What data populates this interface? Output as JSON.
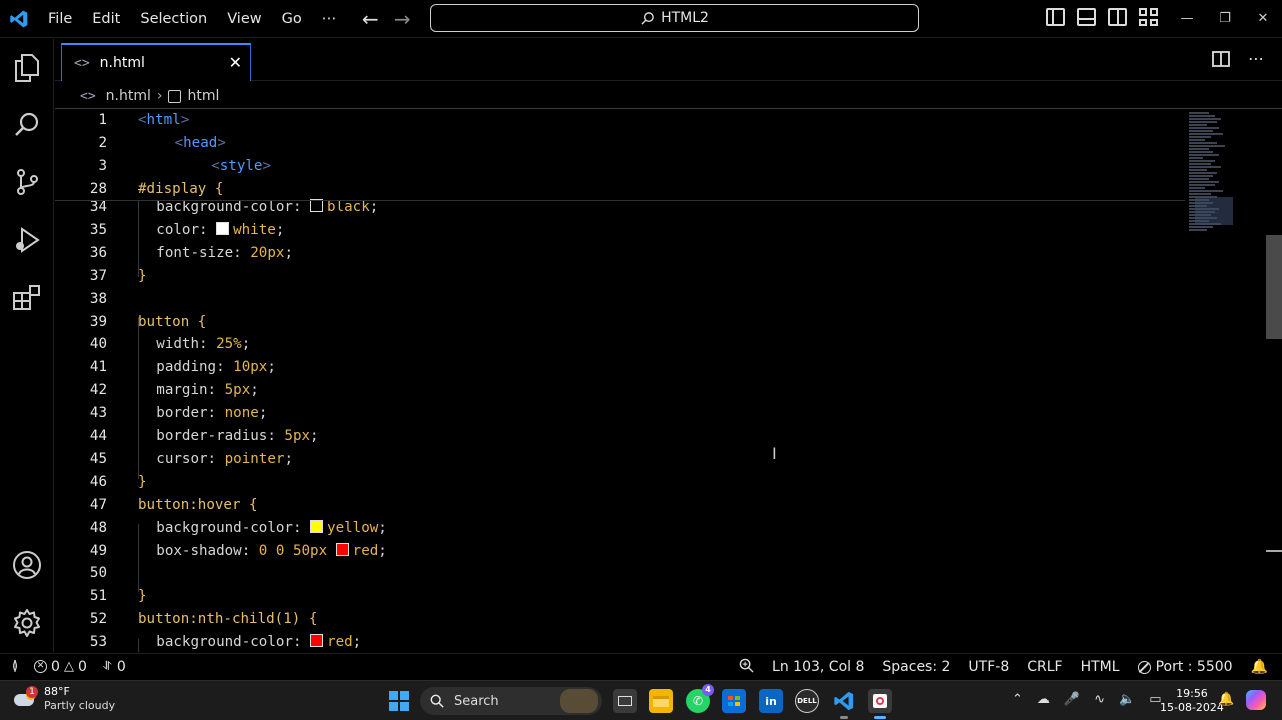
{
  "titlebar": {
    "menu": [
      "File",
      "Edit",
      "Selection",
      "View",
      "Go"
    ],
    "more": "⋯",
    "search_text": "HTML2"
  },
  "tab": {
    "label": "n.html",
    "icon": "<>"
  },
  "breadcrumb": {
    "file": "n.html",
    "symbol": "html"
  },
  "sticky": [
    {
      "n": "1",
      "indent": 0,
      "parts": [
        [
          "t-tag",
          "<"
        ],
        [
          "t-tagname",
          "html"
        ],
        [
          "t-tag",
          ">"
        ]
      ]
    },
    {
      "n": "2",
      "indent": 4,
      "parts": [
        [
          "t-tag",
          "<"
        ],
        [
          "t-tagname",
          "head"
        ],
        [
          "t-tag",
          ">"
        ]
      ]
    },
    {
      "n": "3",
      "indent": 8,
      "parts": [
        [
          "t-tag",
          "<"
        ],
        [
          "t-tagname",
          "style"
        ],
        [
          "t-tag",
          ">"
        ]
      ]
    },
    {
      "n": "28",
      "indent": 0,
      "parts": [
        [
          "t-sel",
          "#display "
        ],
        [
          "t-brace",
          "{"
        ]
      ]
    }
  ],
  "lines": [
    {
      "n": "34",
      "indent": 2,
      "parts": [
        [
          "t-prop",
          "background-color: "
        ],
        [
          "swatch",
          "#000000"
        ],
        [
          "t-val",
          "black"
        ],
        [
          "t-pun",
          ";"
        ]
      ]
    },
    {
      "n": "35",
      "indent": 2,
      "parts": [
        [
          "t-prop",
          "color: "
        ],
        [
          "swatch",
          "#ffffff"
        ],
        [
          "t-val",
          "white"
        ],
        [
          "t-pun",
          ";"
        ]
      ]
    },
    {
      "n": "36",
      "indent": 2,
      "parts": [
        [
          "t-prop",
          "font-size: "
        ],
        [
          "t-num",
          "20px"
        ],
        [
          "t-pun",
          ";"
        ]
      ]
    },
    {
      "n": "37",
      "indent": 0,
      "parts": [
        [
          "t-brace",
          "}"
        ]
      ]
    },
    {
      "n": "38",
      "indent": 0,
      "parts": []
    },
    {
      "n": "39",
      "indent": 0,
      "parts": [
        [
          "t-sel",
          "button "
        ],
        [
          "t-brace",
          "{"
        ]
      ]
    },
    {
      "n": "40",
      "indent": 2,
      "parts": [
        [
          "t-prop",
          "width: "
        ],
        [
          "t-num",
          "25%"
        ],
        [
          "t-pun",
          ";"
        ]
      ]
    },
    {
      "n": "41",
      "indent": 2,
      "parts": [
        [
          "t-prop",
          "padding: "
        ],
        [
          "t-num",
          "10px"
        ],
        [
          "t-pun",
          ";"
        ]
      ]
    },
    {
      "n": "42",
      "indent": 2,
      "parts": [
        [
          "t-prop",
          "margin: "
        ],
        [
          "t-num",
          "5px"
        ],
        [
          "t-pun",
          ";"
        ]
      ]
    },
    {
      "n": "43",
      "indent": 2,
      "parts": [
        [
          "t-prop",
          "border: "
        ],
        [
          "t-val",
          "none"
        ],
        [
          "t-pun",
          ";"
        ]
      ]
    },
    {
      "n": "44",
      "indent": 2,
      "parts": [
        [
          "t-prop",
          "border-radius: "
        ],
        [
          "t-num",
          "5px"
        ],
        [
          "t-pun",
          ";"
        ]
      ]
    },
    {
      "n": "45",
      "indent": 2,
      "parts": [
        [
          "t-prop",
          "cursor: "
        ],
        [
          "t-val",
          "pointer"
        ],
        [
          "t-pun",
          ";"
        ]
      ]
    },
    {
      "n": "46",
      "indent": 0,
      "parts": [
        [
          "t-brace",
          "}"
        ]
      ]
    },
    {
      "n": "47",
      "indent": 0,
      "parts": [
        [
          "t-sel",
          "button:hover "
        ],
        [
          "t-brace",
          "{"
        ]
      ]
    },
    {
      "n": "48",
      "indent": 2,
      "parts": [
        [
          "t-prop",
          "background-color: "
        ],
        [
          "swatch",
          "#ffff00"
        ],
        [
          "t-val",
          "yellow"
        ],
        [
          "t-pun",
          ";"
        ]
      ]
    },
    {
      "n": "49",
      "indent": 2,
      "parts": [
        [
          "t-prop",
          "box-shadow: "
        ],
        [
          "t-num",
          "0 0 50px "
        ],
        [
          "swatch",
          "#ff0000"
        ],
        [
          "t-val",
          "red"
        ],
        [
          "t-pun",
          ";"
        ]
      ]
    },
    {
      "n": "50",
      "indent": 2,
      "parts": []
    },
    {
      "n": "51",
      "indent": 0,
      "parts": [
        [
          "t-brace",
          "}"
        ]
      ]
    },
    {
      "n": "52",
      "indent": 0,
      "parts": [
        [
          "t-sel",
          "button:nth-child(1) "
        ],
        [
          "t-brace",
          "{"
        ]
      ]
    },
    {
      "n": "53",
      "indent": 2,
      "parts": [
        [
          "t-prop",
          "background-color: "
        ],
        [
          "swatch",
          "#ff0000"
        ],
        [
          "t-val",
          "red"
        ],
        [
          "t-pun",
          ";"
        ]
      ]
    }
  ],
  "statusbar": {
    "errors": "0",
    "warnings": "0",
    "ports": "0",
    "position": "Ln 103, Col 8",
    "spaces": "Spaces: 2",
    "encoding": "UTF-8",
    "eol": "CRLF",
    "language": "HTML",
    "port": "Port : 5500"
  },
  "taskbar": {
    "weather_temp": "88°F",
    "weather_desc": "Partly cloudy",
    "weather_badge": "1",
    "search_label": "Search",
    "whatsapp_badge": "4",
    "time": "19:56",
    "date": "15-08-2024"
  },
  "colors": {
    "accent": "#3c8cff",
    "statusbar_bg": "#000000",
    "editor_bg": "#000000"
  }
}
